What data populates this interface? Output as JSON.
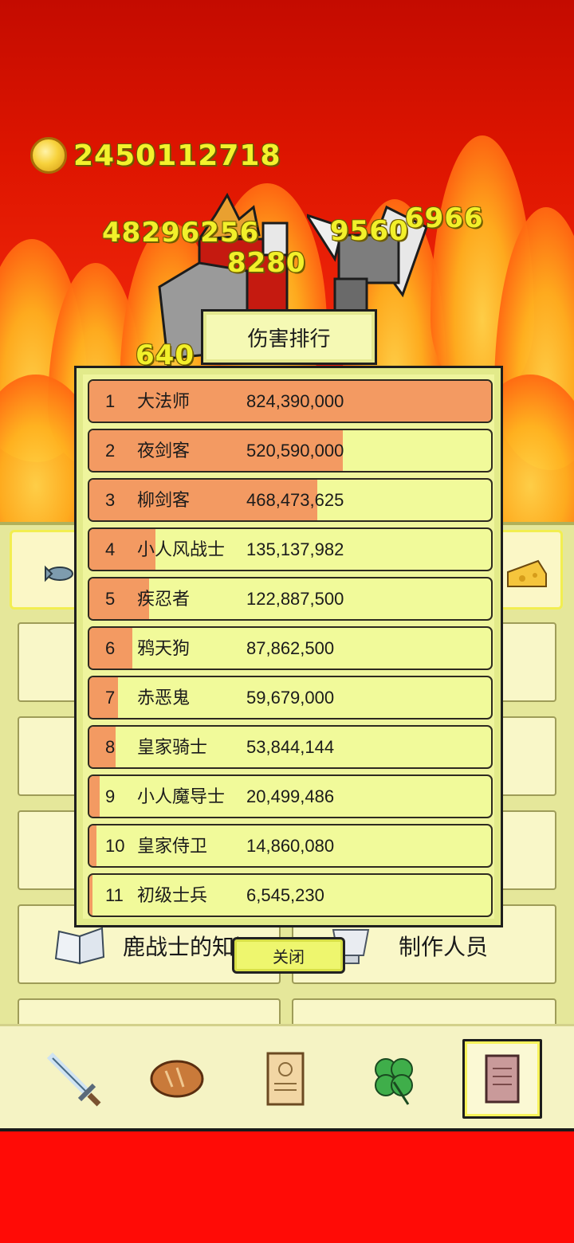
{
  "gold": "2450112718",
  "damage_popups": [
    "48296256",
    "8280",
    "9560",
    "6966",
    "640"
  ],
  "modal": {
    "title": "伤害排行",
    "close_label": "关闭",
    "rows": [
      {
        "rank": "1",
        "name": "大法师",
        "value": "824,390,000",
        "fill": 1.0
      },
      {
        "rank": "2",
        "name": "夜剑客",
        "value": "520,590,000",
        "fill": 0.631
      },
      {
        "rank": "3",
        "name": "柳剑客",
        "value": "468,473,625",
        "fill": 0.568
      },
      {
        "rank": "4",
        "name": "小人风战士",
        "value": "135,137,982",
        "fill": 0.164
      },
      {
        "rank": "5",
        "name": "疾忍者",
        "value": "122,887,500",
        "fill": 0.149
      },
      {
        "rank": "6",
        "name": "鸦天狗",
        "value": "87,862,500",
        "fill": 0.107
      },
      {
        "rank": "7",
        "name": "赤恶鬼",
        "value": "59,679,000",
        "fill": 0.072
      },
      {
        "rank": "8",
        "name": "皇家骑士",
        "value": "53,844,144",
        "fill": 0.065
      },
      {
        "rank": "9",
        "name": "小人魔导士",
        "value": "20,499,486",
        "fill": 0.025
      },
      {
        "rank": "10",
        "name": "皇家侍卫",
        "value": "14,860,080",
        "fill": 0.018
      },
      {
        "rank": "11",
        "name": "初级士兵",
        "value": "6,545,230",
        "fill": 0.008
      }
    ]
  },
  "menu": {
    "knowledge_label": "鹿战士的知识",
    "credits_label": "制作人员"
  },
  "toolbar": {
    "tools": [
      "sword-icon",
      "bread-icon",
      "scroll-icon",
      "clover-icon",
      "book-icon"
    ],
    "active": "book-icon"
  },
  "colors": {
    "bar_fill": "#f39a62",
    "row_bg": "#f1fa9a",
    "gold_text": "#f2f02a"
  }
}
